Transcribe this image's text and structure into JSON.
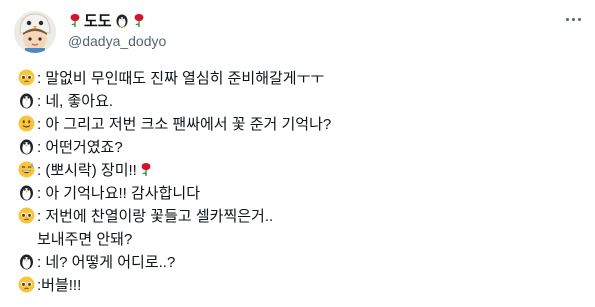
{
  "profile": {
    "display_name": "도도",
    "handle": "@dadya_dodyo",
    "avatar_icon": "chibi-penguin-hat-avatar"
  },
  "tweet_lines": [
    {
      "icon": "pleading-face-emoji",
      "text": ": 말없비 무인때도 진짜 열심히 준비해갈게ㅜㅜ"
    },
    {
      "icon": "penguin-emoji",
      "text": ": 네, 좋아요."
    },
    {
      "icon": "slightly-smiling-face-emoji",
      "text": " : 아 그리고 저번 크소 팬싸에서 꽃 준거 기억나?"
    },
    {
      "icon": "penguin-emoji",
      "text": ": 어떤거였죠?"
    },
    {
      "icon": "grinning-sweat-face-emoji",
      "text": ": (뽀시락) 장미!!"
    },
    {
      "icon": "penguin-emoji",
      "text": ": 아 기억나요!! 감사합니다"
    },
    {
      "icon": "pleading-face-emoji",
      "text": ": 저번에 찬열이랑 꽃들고 셀카찍은거.."
    },
    {
      "icon": "",
      "text": "보내주면 안돼?"
    },
    {
      "icon": "penguin-emoji",
      "text": ": 네? 어떻게 어디로..?"
    },
    {
      "icon": "pleading-face-emoji",
      "text": ":버블!!!"
    }
  ],
  "colors": {
    "text": "#0f1419",
    "secondary": "#536471",
    "rose": "#d0142c",
    "emoji_yellow": "#f7c53b"
  }
}
